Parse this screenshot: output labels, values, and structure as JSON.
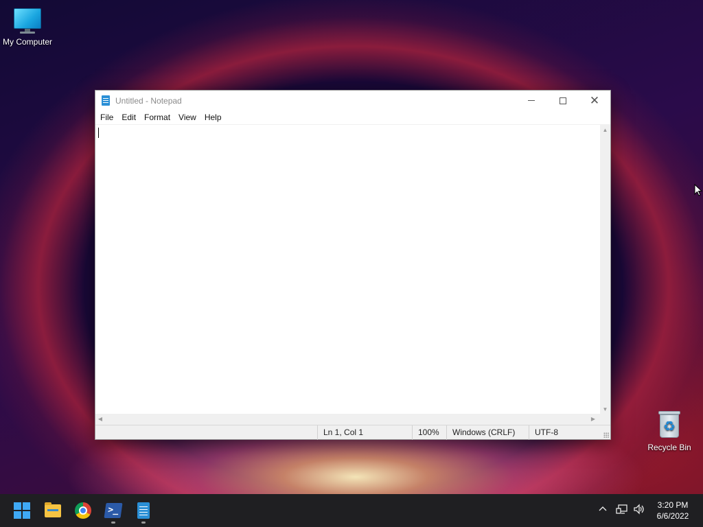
{
  "desktop": {
    "icons": [
      {
        "label": "My Computer",
        "icon": "computer-icon"
      },
      {
        "label": "Recycle Bin",
        "icon": "recycle-bin-icon"
      }
    ]
  },
  "notepad": {
    "title": "Untitled - Notepad",
    "menu": [
      "File",
      "Edit",
      "Format",
      "View",
      "Help"
    ],
    "content": "",
    "status": {
      "position": "Ln 1, Col 1",
      "zoom": "100%",
      "line_ending": "Windows (CRLF)",
      "encoding": "UTF-8"
    }
  },
  "taskbar": {
    "apps": [
      "start-icon",
      "file-explorer-icon",
      "chrome-icon",
      "powershell-icon",
      "notepad-icon"
    ],
    "clock": {
      "time": "3:20 PM",
      "date": "6/6/2022"
    }
  },
  "colors": {
    "accent": "#3fa9f5",
    "taskbar": "#1f1f22"
  }
}
